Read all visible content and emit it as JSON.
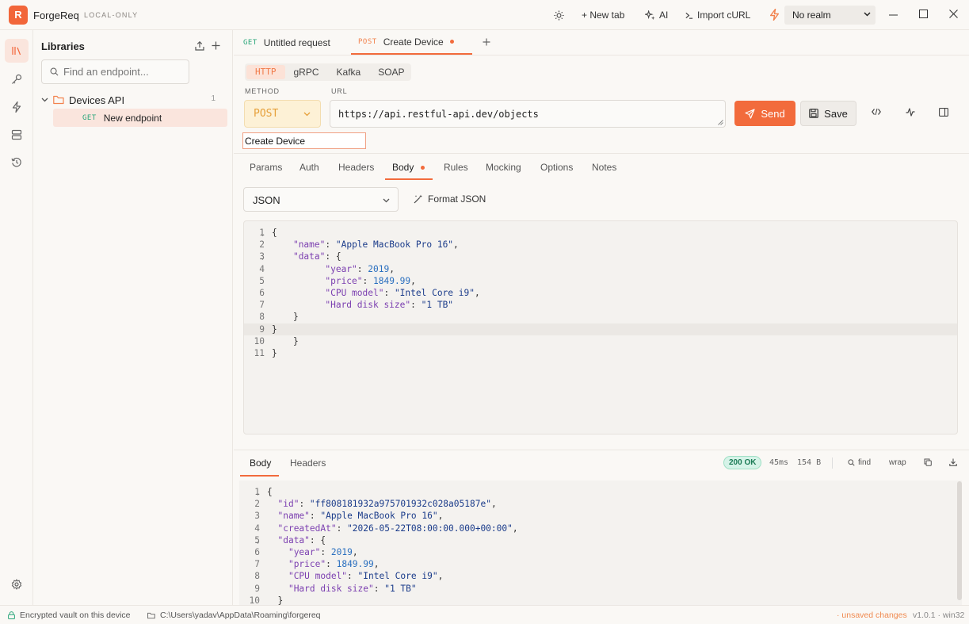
{
  "app": {
    "name": "ForgeReq",
    "mode": "LOCAL-ONLY",
    "logo_letter": "R"
  },
  "titlebar": {
    "new_tab": "+ New tab",
    "ai": "AI",
    "import_curl": "Import cURL",
    "realm": "No realm"
  },
  "sidebar": {
    "title": "Libraries",
    "search_placeholder": "Find an endpoint...",
    "folder": {
      "name": "Devices API",
      "count": "1"
    },
    "endpoint": {
      "method": "GET",
      "name": "New endpoint"
    }
  },
  "tabs": [
    {
      "method": "GET",
      "name": "Untitled request"
    },
    {
      "method": "POST",
      "name": "Create Device"
    }
  ],
  "protocols": [
    "HTTP",
    "gRPC",
    "Kafka",
    "SOAP"
  ],
  "request": {
    "method_label": "METHOD",
    "url_label": "URL",
    "method": "POST",
    "url": "https://api.restful-api.dev/objects",
    "send": "Send",
    "save": "Save",
    "name": "Create Device"
  },
  "subtabs": [
    "Params",
    "Auth",
    "Headers",
    "Body",
    "Rules",
    "Mocking",
    "Options",
    "Notes"
  ],
  "body": {
    "format": "JSON",
    "format_button": "Format JSON",
    "lines": [
      {
        "n": "1",
        "fold": true,
        "html": "{"
      },
      {
        "n": "2",
        "html": "    <span class=k>\"name\"</span>: <span class=s>\"Apple MacBook Pro 16\"</span>,"
      },
      {
        "n": "3",
        "fold": true,
        "html": "    <span class=k>\"data\"</span>: {"
      },
      {
        "n": "4",
        "html": "          <span class=k>\"year\"</span>: <span class=n>2019</span>,"
      },
      {
        "n": "5",
        "html": "          <span class=k>\"price\"</span>: <span class=n>1849.99</span>,"
      },
      {
        "n": "6",
        "html": "          <span class=k>\"CPU model\"</span>: <span class=s>\"Intel Core i9\"</span>,"
      },
      {
        "n": "7",
        "html": "          <span class=k>\"Hard disk size\"</span>: <span class=s>\"1 TB\"</span>"
      },
      {
        "n": "8",
        "html": "    }"
      },
      {
        "n": "9",
        "html": "}",
        "current": true
      },
      {
        "n": "10",
        "html": "    }"
      },
      {
        "n": "11",
        "html": "}"
      }
    ]
  },
  "response": {
    "tabs": [
      "Body",
      "Headers"
    ],
    "status": "200 OK",
    "time": "45ms",
    "size": "154 B",
    "find": "find",
    "wrap": "wrap",
    "lines": [
      {
        "n": "1",
        "fold": true,
        "html": "{"
      },
      {
        "n": "2",
        "html": "  <span class=k>\"id\"</span>: <span class=s>\"ff808181932a975701932c028a05187e\"</span>,"
      },
      {
        "n": "3",
        "html": "  <span class=k>\"name\"</span>: <span class=s>\"Apple MacBook Pro 16\"</span>,"
      },
      {
        "n": "4",
        "html": "  <span class=k>\"createdAt\"</span>: <span class=s>\"2026-05-22T08:00:00.000+00:00\"</span>,"
      },
      {
        "n": "5",
        "fold": true,
        "html": "  <span class=k>\"data\"</span>: {"
      },
      {
        "n": "6",
        "html": "    <span class=k>\"year\"</span>: <span class=n>2019</span>,"
      },
      {
        "n": "7",
        "html": "    <span class=k>\"price\"</span>: <span class=n>1849.99</span>,"
      },
      {
        "n": "8",
        "html": "    <span class=k>\"CPU model\"</span>: <span class=s>\"Intel Core i9\"</span>,"
      },
      {
        "n": "9",
        "html": "    <span class=k>\"Hard disk size\"</span>: <span class=s>\"1 TB\"</span>"
      },
      {
        "n": "10",
        "html": "  }"
      }
    ]
  },
  "statusbar": {
    "vault": "Encrypted vault on this device",
    "path": "C:\\Users\\yadav\\AppData\\Roaming\\forgereq",
    "unsaved": "· unsaved changes",
    "version": "v1.0.1 · win32"
  },
  "colors": {
    "accent": "#f26b3c",
    "method_post": "#e6a03a",
    "get": "#2aa67a",
    "status_ok": "#1b7a55"
  }
}
